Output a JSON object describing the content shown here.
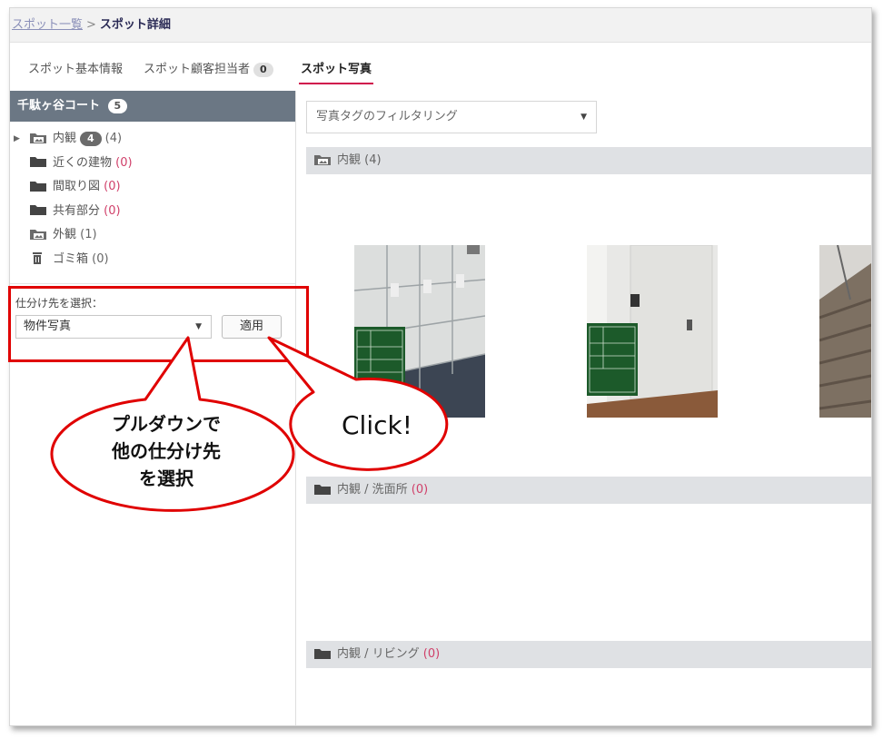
{
  "breadcrumb": {
    "parent": "スポット一覧",
    "separator": ">",
    "current": "スポット詳細"
  },
  "tabs": [
    {
      "label": "スポット基本情報"
    },
    {
      "label": "スポット顧客担当者",
      "badge": "0"
    },
    {
      "label": "スポット写真"
    }
  ],
  "sidebar": {
    "title": "千駄ヶ谷コート",
    "title_badge": "5",
    "folders": [
      {
        "label": "内観",
        "badge": "4",
        "count": "(4)",
        "icon": "photo-folder-icon"
      },
      {
        "label": "近くの建物",
        "count": "(0)",
        "icon": "folder-icon"
      },
      {
        "label": "間取り図",
        "count": "(0)",
        "icon": "folder-icon"
      },
      {
        "label": "共有部分",
        "count": "(0)",
        "icon": "folder-icon"
      },
      {
        "label": "外観",
        "count": "(1)",
        "icon": "photo-folder-icon"
      },
      {
        "label": "ゴミ箱",
        "count": "(0)",
        "icon": "trash-icon"
      }
    ],
    "sort_label": "仕分け先を選択：",
    "sort_select": "物件写真",
    "apply_label": "適用"
  },
  "main": {
    "filter_placeholder": "写真タグのフィルタリング",
    "sections": [
      {
        "label": "内観",
        "count": "(4)"
      },
      {
        "label": "内観 / 洗面所",
        "count": "(0)"
      },
      {
        "label": "内観 / リビング",
        "count": "(0)"
      }
    ]
  },
  "annotations": {
    "bubble_text_line1": "プルダウンで",
    "bubble_text_line2": "他の仕分け先",
    "bubble_text_line3": "を選択",
    "click_text": "Click!",
    "accent": "#e00000"
  },
  "colors": {
    "accent": "#d0104c",
    "sidebar_header": "#6b7784",
    "zero_count": "#d0406a"
  }
}
